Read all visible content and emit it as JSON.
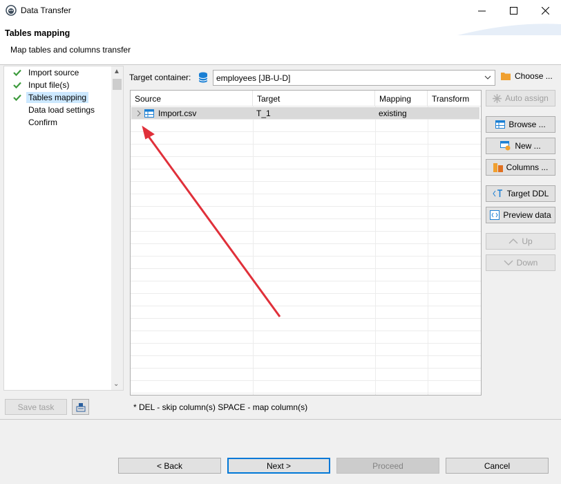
{
  "window": {
    "title": "Data Transfer"
  },
  "header": {
    "title": "Tables mapping",
    "subtitle": "Map tables and columns transfer"
  },
  "steps": [
    {
      "label": "Import source",
      "done": true
    },
    {
      "label": "Input file(s)",
      "done": true
    },
    {
      "label": "Tables mapping",
      "done": true,
      "selected": true
    },
    {
      "label": "Data load settings",
      "done": false
    },
    {
      "label": "Confirm",
      "done": false
    }
  ],
  "left_buttons": {
    "save_task": "Save task"
  },
  "container": {
    "label": "Target container:",
    "value": "employees  [JB-U-D]",
    "choose": "Choose ..."
  },
  "table": {
    "columns": [
      "Source",
      "Target",
      "Mapping",
      "Transform"
    ],
    "rows": [
      {
        "source": "Import.csv",
        "target": "T_1",
        "mapping": "existing",
        "transform": ""
      }
    ]
  },
  "side_buttons": {
    "auto_assign": "Auto assign",
    "browse": "Browse ...",
    "new": "New ...",
    "columns": "Columns ...",
    "target_ddl": "Target DDL",
    "preview_data": "Preview data",
    "up": "Up",
    "down": "Down"
  },
  "hint": "* DEL - skip column(s)  SPACE - map column(s)",
  "footer": {
    "back": "< Back",
    "next": "Next >",
    "proceed": "Proceed",
    "cancel": "Cancel"
  },
  "colors": {
    "accent": "#0078d7",
    "check": "#3c9a3c",
    "arrow": "#e0303a",
    "selection": "#cce8ff"
  }
}
